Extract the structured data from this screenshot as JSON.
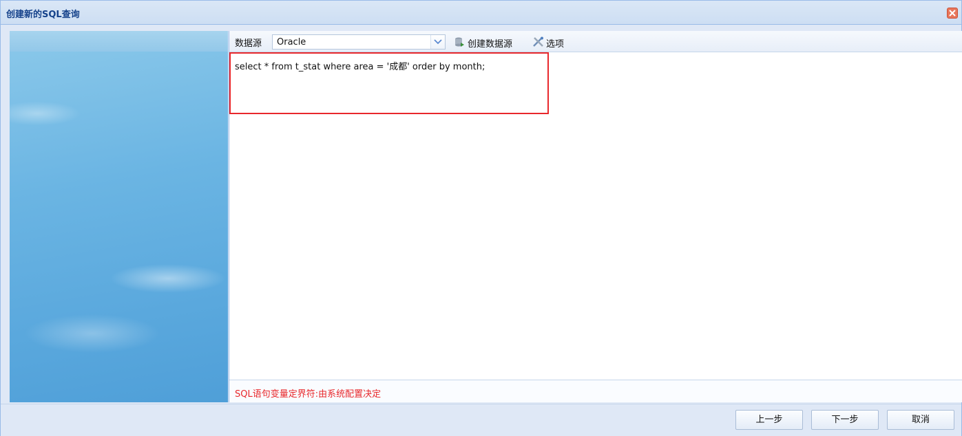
{
  "window": {
    "title": "创建新的SQL查询"
  },
  "toolbar": {
    "datasource_label": "数据源",
    "datasource_value": "Oracle",
    "create_datasource_label": "创建数据源",
    "options_label": "选项"
  },
  "editor": {
    "sql": "select * from t_stat where area = '成都' order by month;"
  },
  "status": {
    "text": "SQL语句变量定界符:由系统配置决定",
    "color": "#e8272b"
  },
  "footer": {
    "prev_label": "上一步",
    "next_label": "下一步",
    "cancel_label": "取消"
  },
  "colors": {
    "title_text": "#15428b",
    "border": "#99bbe8",
    "highlight": "#e8272b"
  }
}
